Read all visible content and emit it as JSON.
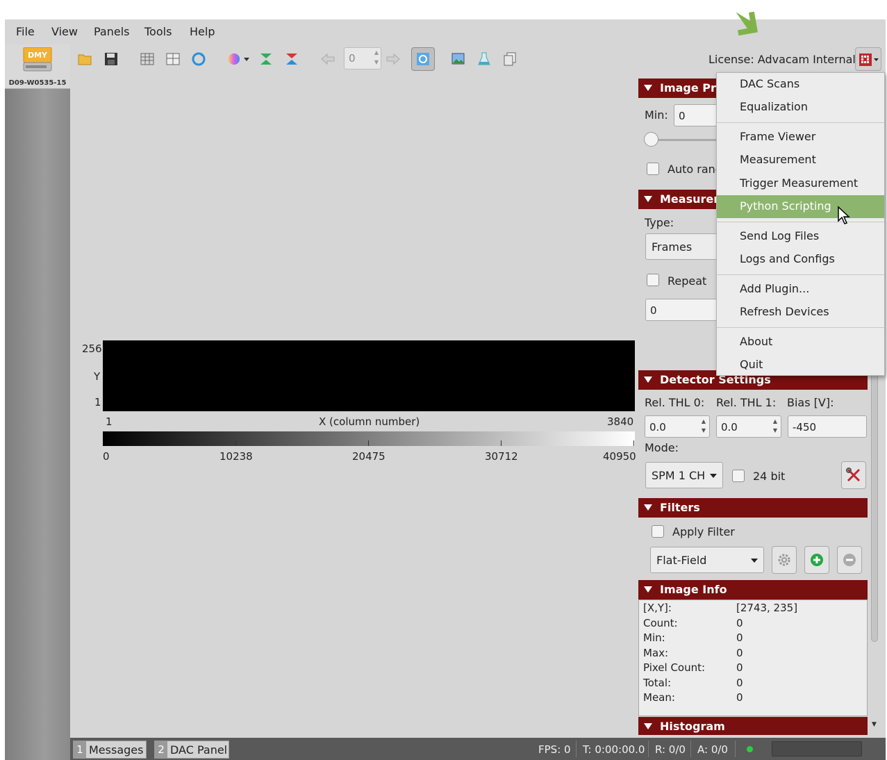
{
  "menubar": {
    "file": "File",
    "view": "View",
    "panels": "Panels",
    "tools": "Tools",
    "help": "Help"
  },
  "toolbar": {
    "frame_index": "0",
    "license": "License: Advacam Internal"
  },
  "device": {
    "badge": "DMY",
    "label": "D09-W0535-15"
  },
  "image": {
    "y_max": "256",
    "y_label": "Y",
    "y_min": "1",
    "x_min": "1",
    "x_label": "X (column number)",
    "x_max": "3840",
    "colorbar_ticks": [
      "0",
      "10238",
      "20475",
      "30712",
      "40950"
    ]
  },
  "panels": {
    "image_processing": {
      "title": "Image Pro",
      "min_label": "Min:",
      "min_value": "0",
      "auto_range": "Auto rang"
    },
    "measurement": {
      "title": "Measurem",
      "type_label": "Type:",
      "type_value": "Frames",
      "repeat": "Repeat",
      "count_value": "0"
    },
    "detector": {
      "title": "Detector Settings",
      "rel_thl0_label": "Rel. THL 0:",
      "rel_thl1_label": "Rel. THL 1:",
      "bias_label": "Bias [V]:",
      "rel_thl0": "0.0",
      "rel_thl1": "0.0",
      "bias": "-450",
      "mode_label": "Mode:",
      "mode_value": "SPM 1 CH",
      "bit24": "24 bit"
    },
    "filters": {
      "title": "Filters",
      "apply_filter": "Apply Filter",
      "filter_value": "Flat-Field"
    },
    "image_info": {
      "title": "Image Info",
      "rows": [
        {
          "key": "[X,Y]:",
          "value": "[2743, 235]"
        },
        {
          "key": "Count:",
          "value": "0"
        },
        {
          "key": "Min:",
          "value": "0"
        },
        {
          "key": "Max:",
          "value": "0"
        },
        {
          "key": "Pixel Count:",
          "value": "0"
        },
        {
          "key": "Total:",
          "value": "0"
        },
        {
          "key": "Mean:",
          "value": "0"
        }
      ]
    },
    "histogram": {
      "title": "Histogram"
    }
  },
  "statusbar": {
    "tab1_num": "1",
    "tab1_label": "Messages",
    "tab2_num": "2",
    "tab2_label": "DAC Panel",
    "fps": "FPS: 0",
    "time": "T: 0:00:00.0",
    "r": "R: 0/0",
    "a": "A: 0/0"
  },
  "dropdown_menu": {
    "items": [
      "DAC Scans",
      "Equalization",
      "Frame Viewer",
      "Measurement",
      "Trigger Measurement",
      "Python Scripting",
      "Send Log Files",
      "Logs and Configs",
      "Add Plugin...",
      "Refresh Devices",
      "About",
      "Quit"
    ],
    "highlighted": "Python Scripting"
  },
  "colors": {
    "section_header": "#7a0f0f",
    "menu_highlight": "#8db56e",
    "status_led": "#2ecc40"
  }
}
